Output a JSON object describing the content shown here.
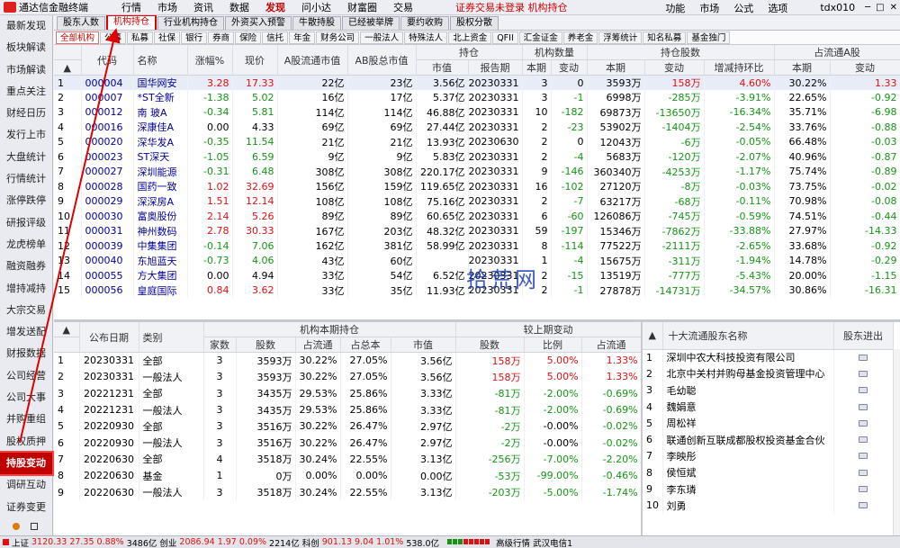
{
  "colors": {
    "accent": "#c00000",
    "up": "#e01010",
    "down": "#149614"
  },
  "menubar": {
    "title": "通达信金融终端",
    "items": [
      "行情",
      "市场",
      "资讯",
      "数据",
      "发现",
      "问小达",
      "财富圈",
      "交易"
    ],
    "active": "发现",
    "notice": "证券交易未登录  机构持仓",
    "right": [
      "功能",
      "市场",
      "公式",
      "选项"
    ],
    "user": "tdx010"
  },
  "sidebar": {
    "items": [
      "最新发现",
      "板块解读",
      "市场解读",
      "重点关注",
      "财经日历",
      "发行上市",
      "大盘统计",
      "行情统计",
      "涨停跌停",
      "研报评级",
      "龙虎榜单",
      "融资融券",
      "增持减持",
      "大宗交易",
      "增发送配",
      "财报数据",
      "公司经营",
      "公司大事",
      "并购重组",
      "股权质押",
      "持股变动",
      "调研互动",
      "证券变更"
    ],
    "active": "持股变动"
  },
  "tabs1": [
    "股东人数",
    "机构持仓",
    "行业机构持仓",
    "外资买入预警",
    "牛散持股",
    "已经被举牌",
    "要约收购",
    "股权分散"
  ],
  "tabs1_active": "机构持仓",
  "tabs2": [
    "全部机构",
    "公募",
    "私募",
    "社保",
    "银行",
    "券商",
    "保险",
    "信托",
    "年金",
    "财务公司",
    "一般法人",
    "特殊法人",
    "北上资金",
    "QFII",
    "汇金证金",
    "养老金",
    "浮筹统计",
    "知名私募",
    "基金独门"
  ],
  "tabs2_active": "全部机构",
  "top_table": {
    "groups": {
      "holding": "持仓",
      "inst_count": "机构数量",
      "holding_shares": "持仓股数",
      "float_a": "占流通A股"
    },
    "headers": [
      "",
      "代码",
      "名称",
      "涨幅%",
      "现价",
      "A股流通市值",
      "AB股总市值",
      "市值",
      "报告期",
      "本期",
      "变动",
      "本期",
      "变动",
      "增减持环比",
      "本期",
      "变动"
    ],
    "rows": [
      [
        "1",
        "000004",
        "国华网安",
        "3.28",
        "17.33",
        "22亿",
        "23亿",
        "3.56亿",
        "20230331",
        "3",
        "0",
        "3593万",
        "158万",
        "4.60%",
        "30.22%",
        "1.33"
      ],
      [
        "2",
        "000007",
        "*ST全新",
        "-1.38",
        "5.02",
        "16亿",
        "17亿",
        "5.37亿",
        "20230331",
        "3",
        "-1",
        "6998万",
        "-285万",
        "-3.91%",
        "22.65%",
        "-0.92"
      ],
      [
        "3",
        "000012",
        "南 玻A",
        "-0.34",
        "5.81",
        "114亿",
        "114亿",
        "46.88亿",
        "20230331",
        "10",
        "-182",
        "69873万",
        "-13650万",
        "-16.34%",
        "35.71%",
        "-6.98"
      ],
      [
        "4",
        "000016",
        "深康佳A",
        "0.00",
        "4.33",
        "69亿",
        "69亿",
        "27.44亿",
        "20230331",
        "2",
        "-23",
        "53902万",
        "-1404万",
        "-2.54%",
        "33.76%",
        "-0.88"
      ],
      [
        "5",
        "000020",
        "深华发A",
        "-0.35",
        "11.54",
        "21亿",
        "21亿",
        "13.93亿",
        "20230630",
        "2",
        "0",
        "12043万",
        "-6万",
        "-0.05%",
        "66.48%",
        "-0.03"
      ],
      [
        "6",
        "000023",
        "ST深天",
        "-1.05",
        "6.59",
        "9亿",
        "9亿",
        "5.83亿",
        "20230331",
        "2",
        "-4",
        "5683万",
        "-120万",
        "-2.07%",
        "40.96%",
        "-0.87"
      ],
      [
        "7",
        "000027",
        "深圳能源",
        "-0.31",
        "6.48",
        "308亿",
        "308亿",
        "220.17亿",
        "20230331",
        "9",
        "-146",
        "360340万",
        "-4253万",
        "-1.17%",
        "75.74%",
        "-0.89"
      ],
      [
        "8",
        "000028",
        "国药一致",
        "1.02",
        "32.69",
        "156亿",
        "159亿",
        "119.65亿",
        "20230331",
        "16",
        "-102",
        "27120万",
        "-8万",
        "-0.03%",
        "73.75%",
        "-0.02"
      ],
      [
        "9",
        "000029",
        "深深房A",
        "1.51",
        "12.14",
        "108亿",
        "108亿",
        "75.16亿",
        "20230331",
        "2",
        "-7",
        "63217万",
        "-68万",
        "-0.11%",
        "70.98%",
        "-0.08"
      ],
      [
        "10",
        "000030",
        "富奥股份",
        "2.14",
        "5.26",
        "89亿",
        "89亿",
        "60.65亿",
        "20230331",
        "6",
        "-60",
        "126086万",
        "-745万",
        "-0.59%",
        "74.51%",
        "-0.44"
      ],
      [
        "11",
        "000031",
        "神州数码",
        "2.78",
        "30.33",
        "167亿",
        "203亿",
        "48.32亿",
        "20230331",
        "59",
        "-197",
        "15346万",
        "-7862万",
        "-33.88%",
        "27.97%",
        "-14.33"
      ],
      [
        "12",
        "000039",
        "中集集团",
        "-0.14",
        "7.06",
        "162亿",
        "381亿",
        "58.99亿",
        "20230331",
        "8",
        "-114",
        "77522万",
        "-2111万",
        "-2.65%",
        "33.68%",
        "-0.92"
      ],
      [
        "13",
        "000040",
        "东旭蓝天",
        "-0.73",
        "4.06",
        "43亿",
        "60亿",
        "",
        "20230331",
        "1",
        "-4",
        "15675万",
        "-311万",
        "-1.94%",
        "14.78%",
        "-0.29"
      ],
      [
        "14",
        "000055",
        "方大集团",
        "0.00",
        "4.94",
        "33亿",
        "54亿",
        "6.52亿",
        "20230331",
        "2",
        "-15",
        "13519万",
        "-777万",
        "-5.43%",
        "20.00%",
        "-1.15"
      ],
      [
        "15",
        "000056",
        "皇庭国际",
        "0.84",
        "3.62",
        "33亿",
        "35亿",
        "11.93亿",
        "20230331",
        "2",
        "-1",
        "27878万",
        "-14731万",
        "-34.57%",
        "30.86%",
        "-16.31"
      ]
    ]
  },
  "bottom_table": {
    "groups": {
      "inst_holding": "机构本期持仓",
      "last_change": "较上期变动"
    },
    "headers": [
      "",
      "公布日期",
      "类别",
      "家数",
      "股数",
      "占流通",
      "占总本",
      "市值",
      "股数",
      "比例",
      "占流通"
    ],
    "rows": [
      [
        "1",
        "20230331",
        "全部",
        "3",
        "3593万",
        "30.22%",
        "27.05%",
        "3.56亿",
        "158万",
        "5.00%",
        "1.33%"
      ],
      [
        "2",
        "20230331",
        "一般法人",
        "3",
        "3593万",
        "30.22%",
        "27.05%",
        "3.56亿",
        "158万",
        "5.00%",
        "1.33%"
      ],
      [
        "3",
        "20221231",
        "全部",
        "3",
        "3435万",
        "29.53%",
        "25.86%",
        "3.33亿",
        "-81万",
        "-2.00%",
        "-0.69%"
      ],
      [
        "4",
        "20221231",
        "一般法人",
        "3",
        "3435万",
        "29.53%",
        "25.86%",
        "3.33亿",
        "-81万",
        "-2.00%",
        "-0.69%"
      ],
      [
        "5",
        "20220930",
        "全部",
        "3",
        "3516万",
        "30.22%",
        "26.47%",
        "2.97亿",
        "-2万",
        "-0.00%",
        "-0.02%"
      ],
      [
        "6",
        "20220930",
        "一般法人",
        "3",
        "3516万",
        "30.22%",
        "26.47%",
        "2.97亿",
        "-2万",
        "-0.00%",
        "-0.02%"
      ],
      [
        "7",
        "20220630",
        "全部",
        "4",
        "3518万",
        "30.24%",
        "22.55%",
        "3.13亿",
        "-256万",
        "-7.00%",
        "-2.20%"
      ],
      [
        "8",
        "20220630",
        "基金",
        "1",
        "0万",
        "0.00%",
        "0.00%",
        "0.00亿",
        "-53万",
        "-99.00%",
        "-0.46%"
      ],
      [
        "9",
        "20220630",
        "一般法人",
        "3",
        "3518万",
        "30.24%",
        "22.55%",
        "3.13亿",
        "-203万",
        "-5.00%",
        "-1.74%"
      ]
    ]
  },
  "holders": {
    "headers": [
      "",
      "十大流通股东名称",
      "股东进出"
    ],
    "rows": [
      [
        "1",
        "深圳中农大科技投资有限公司"
      ],
      [
        "2",
        "北京中关村并购母基金投资管理中心"
      ],
      [
        "3",
        "毛幼聪"
      ],
      [
        "4",
        "魏娟意"
      ],
      [
        "5",
        "周松祥"
      ],
      [
        "6",
        "联通创新互联成都股权投资基金合伙"
      ],
      [
        "7",
        "李映彤"
      ],
      [
        "8",
        "侯恒斌"
      ],
      [
        "9",
        "李东璘"
      ],
      [
        "10",
        "刘勇"
      ]
    ]
  },
  "watermark": "拾荒网",
  "statusbar": {
    "sh_label": "上证",
    "sh_index": "3120.33",
    "sh_chg": "27.35",
    "sh_pct": "0.88%",
    "sh_amt": "3486亿",
    "cy_label": "创业",
    "cy_index": "2086.94",
    "cy_chg": "1.97",
    "cy_pct": "0.09%",
    "cy_amt": "2214亿",
    "kc_label": "科创",
    "kc_index": "901.13",
    "kc_chg": "9.04",
    "kc_pct": "1.01%",
    "kc_amt": "538.0亿",
    "hq": "高级行情",
    "server": "武汉电信1"
  }
}
